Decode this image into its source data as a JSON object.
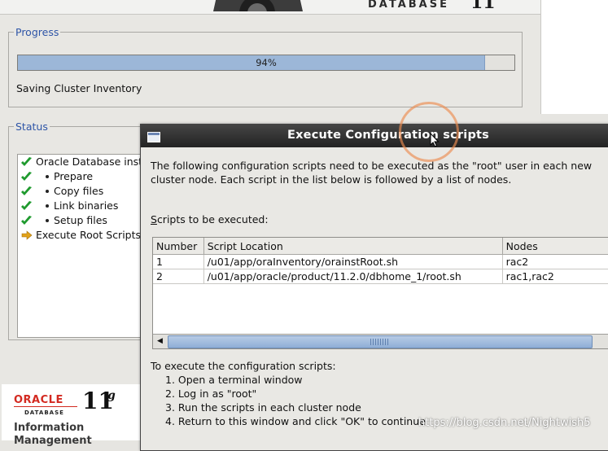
{
  "banner": {
    "brand": "DATABASE",
    "version_fragment": "11"
  },
  "progress": {
    "legend": "Progress",
    "percent_text": "94%",
    "fraction": 0.94,
    "message": "Saving Cluster Inventory"
  },
  "status": {
    "legend": "Status",
    "items": [
      {
        "label": "Oracle Database insta",
        "state": "done",
        "level": 0
      },
      {
        "label": "Prepare",
        "state": "done",
        "level": 1
      },
      {
        "label": "Copy files",
        "state": "done",
        "level": 1
      },
      {
        "label": "Link binaries",
        "state": "done",
        "level": 1
      },
      {
        "label": "Setup files",
        "state": "done",
        "level": 1
      },
      {
        "label": "Execute Root Scripts",
        "state": "current",
        "level": 0
      }
    ]
  },
  "logo": {
    "oracle": "ORACLE",
    "database": "DATABASE",
    "version": "11",
    "version_suffix": "g",
    "line1": "Information",
    "line2": "Management"
  },
  "dialog": {
    "title": "Execute Configuration scripts",
    "intro": "The following configuration scripts need to be executed as the \"root\" user in each new cluster node. Each script in the list below is followed by a list of nodes.",
    "scripts_label_mnemonic": "S",
    "scripts_label_rest": "cripts to be executed:",
    "table": {
      "headers": [
        "Number",
        "Script Location",
        "Nodes"
      ],
      "rows": [
        [
          "1",
          "/u01/app/oraInventory/orainstRoot.sh",
          "rac2"
        ],
        [
          "2",
          "/u01/app/oracle/product/11.2.0/dbhome_1/root.sh",
          "rac1,rac2"
        ]
      ]
    },
    "instructions_title": "To execute the configuration scripts:",
    "steps": [
      "1. Open a terminal window",
      "2. Log in as \"root\"",
      "3. Run the scripts in each cluster node",
      "4. Return to this window and click \"OK\" to continue"
    ]
  },
  "watermark": "https://blog.csdn.net/Nightwish5",
  "colors": {
    "legend": "#2e55a7",
    "progress_fill": "#9cb7d8",
    "titlebar": "#2b2b2b",
    "check": "#1f9a2e",
    "arrow": "#e1a21a",
    "oracle_red": "#d32a21"
  }
}
